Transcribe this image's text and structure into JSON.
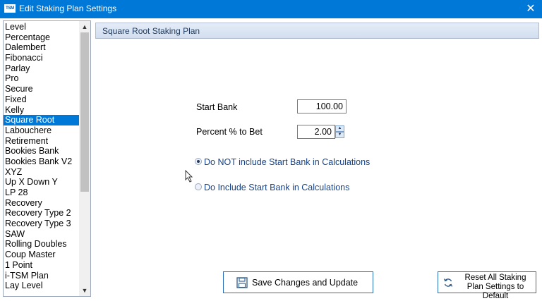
{
  "window": {
    "app_badge": "TSM",
    "title": "Edit Staking Plan Settings"
  },
  "plans": [
    "Level",
    "Percentage",
    "Dalembert",
    "Fibonacci",
    "Parlay",
    "Pro",
    "Secure",
    "Fixed",
    "Kelly",
    "Square Root",
    "Labouchere",
    "Retirement",
    "Bookies Bank",
    "Bookies Bank V2",
    "XYZ",
    "Up X Down Y",
    "LP 28",
    "Recovery",
    "Recovery Type 2",
    "Recovery Type 3",
    "SAW",
    "Rolling Doubles",
    "Coup Master",
    "1 Point",
    "i-TSM Plan",
    "Lay Level"
  ],
  "selected_plan_index": 9,
  "panel": {
    "title": "Square Root Staking Plan"
  },
  "form": {
    "start_bank_label": "Start Bank",
    "start_bank_value": "100.00",
    "percent_label": "Percent % to Bet",
    "percent_value": "2.00"
  },
  "options": {
    "exclude_label": "Do NOT include Start Bank in Calculations",
    "include_label": "Do Include Start Bank in Calculations",
    "selected": "exclude"
  },
  "buttons": {
    "save_label": "Save Changes and Update",
    "reset_label": "Reset All Staking Plan Settings to Default"
  },
  "colors": {
    "titlebar": "#0078d7",
    "selection": "#0078d7",
    "accent_text": "#15428b"
  }
}
